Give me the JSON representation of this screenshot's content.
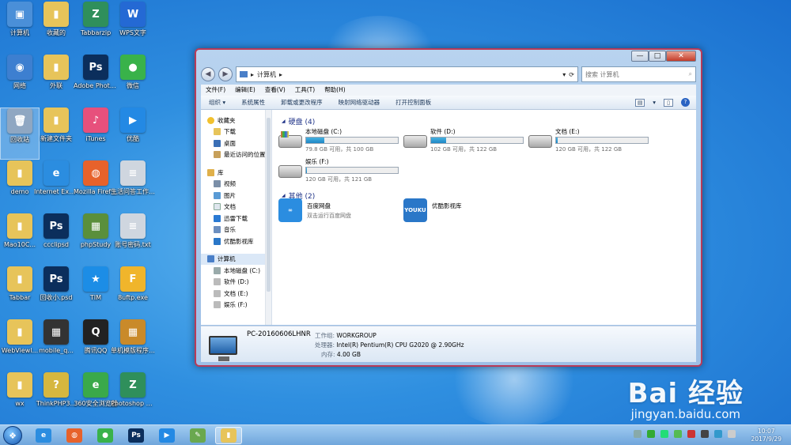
{
  "desktop": {
    "icons": [
      {
        "label": "计算机",
        "glyph": "▣",
        "color": "#4a8fd8"
      },
      {
        "label": "收藏的",
        "glyph": "▮",
        "color": "#e7c45a"
      },
      {
        "label": "Tabbarzip",
        "glyph": "Z",
        "color": "#2f8f5b"
      },
      {
        "label": "WPS文字",
        "glyph": "W",
        "color": "#2469d4"
      },
      {
        "label": "网络",
        "glyph": "◉",
        "color": "#3d7fd0"
      },
      {
        "label": "外联",
        "glyph": "▮",
        "color": "#e7c45a"
      },
      {
        "label": "Adobe Photosh...",
        "glyph": "Ps",
        "color": "#0b2e5c"
      },
      {
        "label": "微信",
        "glyph": "●",
        "color": "#39b24a"
      },
      {
        "label": "回收站",
        "glyph": "🗑",
        "color": "#8fa7c2"
      },
      {
        "label": "新建文件夹",
        "glyph": "▮",
        "color": "#e7c45a"
      },
      {
        "label": "iTunes",
        "glyph": "♪",
        "color": "#e7507c"
      },
      {
        "label": "优酷",
        "glyph": "▶",
        "color": "#2389e4"
      },
      {
        "label": "demo",
        "glyph": "▮",
        "color": "#e7c45a"
      },
      {
        "label": "Internet Explorer",
        "glyph": "e",
        "color": "#2b8de0"
      },
      {
        "label": "Mozilla Firefox",
        "glyph": "◍",
        "color": "#e7622b"
      },
      {
        "label": "生活问答工作资料.txt",
        "glyph": "≡",
        "color": "#cfd6df"
      },
      {
        "label": "Mao10C...",
        "glyph": "▮",
        "color": "#e7c45a"
      },
      {
        "label": "ccclipsd",
        "glyph": "Ps",
        "color": "#0b2e5c"
      },
      {
        "label": "phpStudy",
        "glyph": "▦",
        "color": "#5a8f3b"
      },
      {
        "label": "账号密码.txt",
        "glyph": "≡",
        "color": "#cfd6df"
      },
      {
        "label": "Tabbar",
        "glyph": "▮",
        "color": "#e7c45a"
      },
      {
        "label": "回收小.psd",
        "glyph": "Ps",
        "color": "#0b2e5c"
      },
      {
        "label": "TIM",
        "glyph": "★",
        "color": "#1c8de6"
      },
      {
        "label": "8uftp.exe",
        "glyph": "F",
        "color": "#f0b52b"
      },
      {
        "label": "WebViewl...",
        "glyph": "▮",
        "color": "#e7c45a"
      },
      {
        "label": "mobile_q...",
        "glyph": "▦",
        "color": "#333333"
      },
      {
        "label": "腾讯QQ",
        "glyph": "Q",
        "color": "#222222"
      },
      {
        "label": "单机模版程序.exe",
        "glyph": "▦",
        "color": "#c98a2a"
      },
      {
        "label": "wx",
        "glyph": "▮",
        "color": "#e7c45a"
      },
      {
        "label": "ThinkPHP3...",
        "glyph": "?",
        "color": "#d6b73f"
      },
      {
        "label": "360安全浏览器",
        "glyph": "e",
        "color": "#3aa94a"
      },
      {
        "label": "Photoshop 2015CC破...",
        "glyph": "Z",
        "color": "#2f8f5b"
      }
    ]
  },
  "window": {
    "controls": {
      "minimize": "—",
      "maximize": "□",
      "close": "✕"
    },
    "nav": {
      "back": "◀",
      "forward": "▶"
    },
    "address": {
      "path": "计算机",
      "arrow": "▸"
    },
    "search": {
      "placeholder": "搜索 计算机"
    },
    "menu": [
      "文件(F)",
      "编辑(E)",
      "查看(V)",
      "工具(T)",
      "帮助(H)"
    ],
    "toolbar": {
      "organize": "组织 ▾",
      "system_properties": "系统属性",
      "uninstall": "卸载或更改程序",
      "map_drive": "映射网络驱动器",
      "control_panel": "打开控制面板"
    },
    "sidebar": {
      "favorites_head": "收藏夹",
      "favorites": [
        "下载",
        "桌面",
        "最近访问的位置"
      ],
      "library_head": "库",
      "library": [
        "视频",
        "图片",
        "文档",
        "迅雷下载",
        "音乐",
        "优酷影视库"
      ],
      "computer_head": "计算机",
      "computer": [
        "本地磁盘 (C:)",
        "软件 (D:)",
        "文档 (E:)",
        "娱乐 (F:)"
      ]
    },
    "groups": {
      "drives_head": "硬盘 (4)",
      "other_head": "其他 (2)"
    },
    "drives": [
      {
        "name": "本地磁盘 (C:)",
        "free": "79.8 GB 可用，共 100 GB",
        "used_pct": 20.2,
        "system": true
      },
      {
        "name": "软件 (D:)",
        "free": "102 GB 可用，共 122 GB",
        "used_pct": 16.4,
        "system": false
      },
      {
        "name": "文档 (E:)",
        "free": "120 GB 可用，共 122 GB",
        "used_pct": 1.6,
        "system": false
      },
      {
        "name": "娱乐 (F:)",
        "free": "120 GB 可用，共 121 GB",
        "used_pct": 0.8,
        "system": false
      }
    ],
    "others": [
      {
        "name": "百度网盘",
        "sub": "双击运行百度网盘",
        "color": "#2b8de0",
        "glyph": "∞"
      },
      {
        "name": "优酷影视库",
        "sub": "",
        "color": "#2a77c8",
        "glyph": "YOUKU"
      }
    ],
    "details": {
      "pc_name": "PC-20160606LHNR",
      "workgroup_label": "工作组:",
      "workgroup": "WORKGROUP",
      "cpu_label": "处理器:",
      "cpu": "Intel(R) Pentium(R) CPU G2020 @ 2.90GHz",
      "ram_label": "内存:",
      "ram": "4.00 GB"
    }
  },
  "taskbar": {
    "start_glyph": "❖",
    "apps": [
      {
        "glyph": "e",
        "color": "#2b8de0",
        "active": false
      },
      {
        "glyph": "◍",
        "color": "#e7622b",
        "active": false
      },
      {
        "glyph": "●",
        "color": "#39b24a",
        "active": false
      },
      {
        "glyph": "Ps",
        "color": "#0b2e5c",
        "active": false
      },
      {
        "glyph": "▶",
        "color": "#2389e4",
        "active": false
      },
      {
        "glyph": "✎",
        "color": "#6aa84f",
        "active": false
      },
      {
        "glyph": "▮",
        "color": "#e7c45a",
        "active": true
      }
    ],
    "tray_colors": [
      "#8aa",
      "#3a3",
      "#2d7",
      "#5b5",
      "#c33",
      "#444",
      "#39c",
      "#ccc"
    ],
    "time": "10:07",
    "date": "2017/9/29"
  },
  "watermark": {
    "brand": "Bai 经验",
    "url": "jingyan.baidu.com"
  }
}
